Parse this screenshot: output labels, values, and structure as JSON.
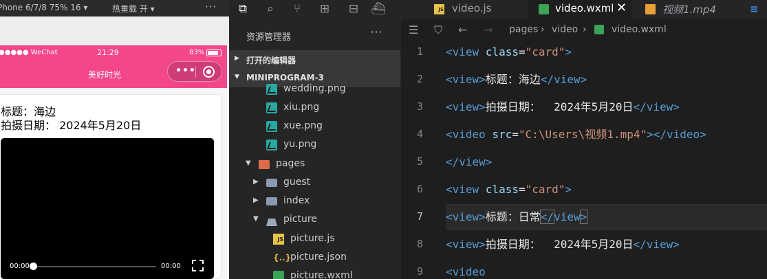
{
  "simulator": {
    "device_label": "Phone 6/7/8 75% 16 ▾",
    "hotreload_label": "热重载 开 ▾",
    "more": "···",
    "status": {
      "carrier": "●●●●● WeChat",
      "time": "21:29",
      "battery": "83%"
    },
    "nav_title": "美好时光",
    "capsule_dots": "•••",
    "card": {
      "title": "标题：海边",
      "date": "拍摄日期：  2024年5月20日",
      "video": {
        "current_time": "00:00",
        "duration": "00:00",
        "progress": 0
      }
    }
  },
  "explorer": {
    "activity_icons": [
      "copy-icon",
      "search-icon",
      "source-control-icon",
      "extensions-icon",
      "remote-icon",
      "docker-icon"
    ],
    "header": "资源管理器",
    "header_more": "···",
    "sections": {
      "open_editors": "打开的编辑器",
      "project": "MINIPROGRAM-3"
    },
    "files": [
      {
        "label": "wedding.png",
        "type": "png"
      },
      {
        "label": "xiu.png",
        "type": "png"
      },
      {
        "label": "xue.png",
        "type": "png"
      },
      {
        "label": "yu.png",
        "type": "png"
      },
      {
        "label": "pages",
        "type": "folder-open"
      },
      {
        "label": "guest",
        "type": "folder"
      },
      {
        "label": "index",
        "type": "folder"
      },
      {
        "label": "picture",
        "type": "folder-open"
      },
      {
        "label": "picture.js",
        "type": "js"
      },
      {
        "label": "picture.json",
        "type": "json"
      },
      {
        "label": "picture.wxml",
        "type": "wxml"
      }
    ]
  },
  "editor": {
    "tabs": [
      {
        "label": "video.js",
        "type": "js",
        "active": false
      },
      {
        "label": "video.wxml",
        "type": "wxml",
        "active": true
      },
      {
        "label": "视频1.mp4",
        "type": "mp4",
        "active": false
      }
    ],
    "close_glyph": "✕",
    "breadcrumb": [
      "pages",
      "video",
      "video.wxml"
    ],
    "current_line": 7,
    "lines": [
      {
        "n": "1",
        "parts": [
          {
            "c": "tag",
            "t": "<view "
          },
          {
            "c": "attr",
            "t": "class"
          },
          {
            "c": "txt",
            "t": "="
          },
          {
            "c": "str",
            "t": "\"card\""
          },
          {
            "c": "tag",
            "t": ">"
          }
        ]
      },
      {
        "n": "2",
        "parts": [
          {
            "c": "tag",
            "t": "<view>"
          },
          {
            "c": "txt",
            "t": "标题：海边"
          },
          {
            "c": "tag",
            "t": "</view>"
          }
        ]
      },
      {
        "n": "3",
        "parts": [
          {
            "c": "tag",
            "t": "<view>"
          },
          {
            "c": "txt",
            "t": "拍摄日期：  2024年5月20日"
          },
          {
            "c": "tag",
            "t": "</view>"
          }
        ]
      },
      {
        "n": "4",
        "parts": [
          {
            "c": "tag",
            "t": "<video "
          },
          {
            "c": "attr",
            "t": "src"
          },
          {
            "c": "txt",
            "t": "="
          },
          {
            "c": "str",
            "t": "\"C:\\Users\\视频1.mp4\""
          },
          {
            "c": "tag",
            "t": "></video>"
          }
        ]
      },
      {
        "n": "5",
        "parts": [
          {
            "c": "tag",
            "t": "</view>"
          }
        ]
      },
      {
        "n": "6",
        "parts": [
          {
            "c": "tag",
            "t": "<view "
          },
          {
            "c": "attr",
            "t": "class"
          },
          {
            "c": "txt",
            "t": "="
          },
          {
            "c": "str",
            "t": "\"card\""
          },
          {
            "c": "tag",
            "t": ">"
          }
        ]
      },
      {
        "n": "7",
        "parts": [
          {
            "c": "tag",
            "t": "<view>"
          },
          {
            "c": "txt",
            "t": "标题：日常"
          },
          {
            "c": "tag brk",
            "t": "</"
          },
          {
            "c": "tag",
            "t": "view"
          },
          {
            "c": "tag brk",
            "t": ">"
          }
        ]
      },
      {
        "n": "8",
        "parts": [
          {
            "c": "tag",
            "t": "<view>"
          },
          {
            "c": "txt",
            "t": "拍摄日期：  2024年5月20日"
          },
          {
            "c": "tag",
            "t": "</view>"
          }
        ]
      },
      {
        "n": "9",
        "parts": [
          {
            "c": "tag",
            "t": "<video"
          }
        ]
      }
    ]
  },
  "colors": {
    "accent_pink": "#f4478b",
    "tag_blue": "#569cd6",
    "string_orange": "#ce9178",
    "attr_lightblue": "#9cdcfe"
  }
}
